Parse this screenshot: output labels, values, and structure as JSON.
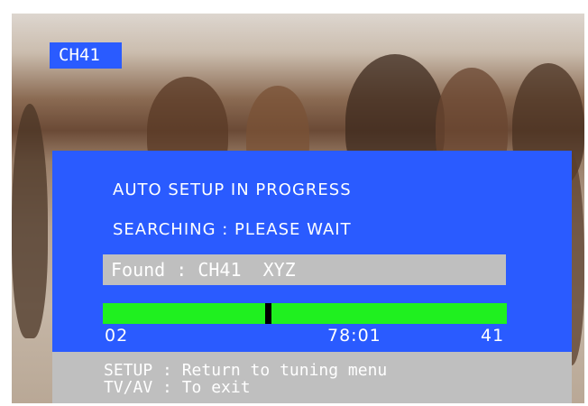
{
  "channel_badge": "CH41",
  "dialog": {
    "title": "AUTO SETUP IN PROGRESS",
    "status": "SEARCHING : PLEASE WAIT",
    "found_text": "Found : CH41  XYZ",
    "progress": {
      "fraction": 0.41,
      "left_label": "02",
      "center_label": "78:01",
      "right_label": "41"
    }
  },
  "footer": {
    "line1": "SETUP : Return to tuning menu",
    "line2": "TV/AV : To exit"
  },
  "colors": {
    "osd_blue": "#2a5bff",
    "osd_gray": "#bfbfbf",
    "progress_green": "#1ff01f"
  }
}
